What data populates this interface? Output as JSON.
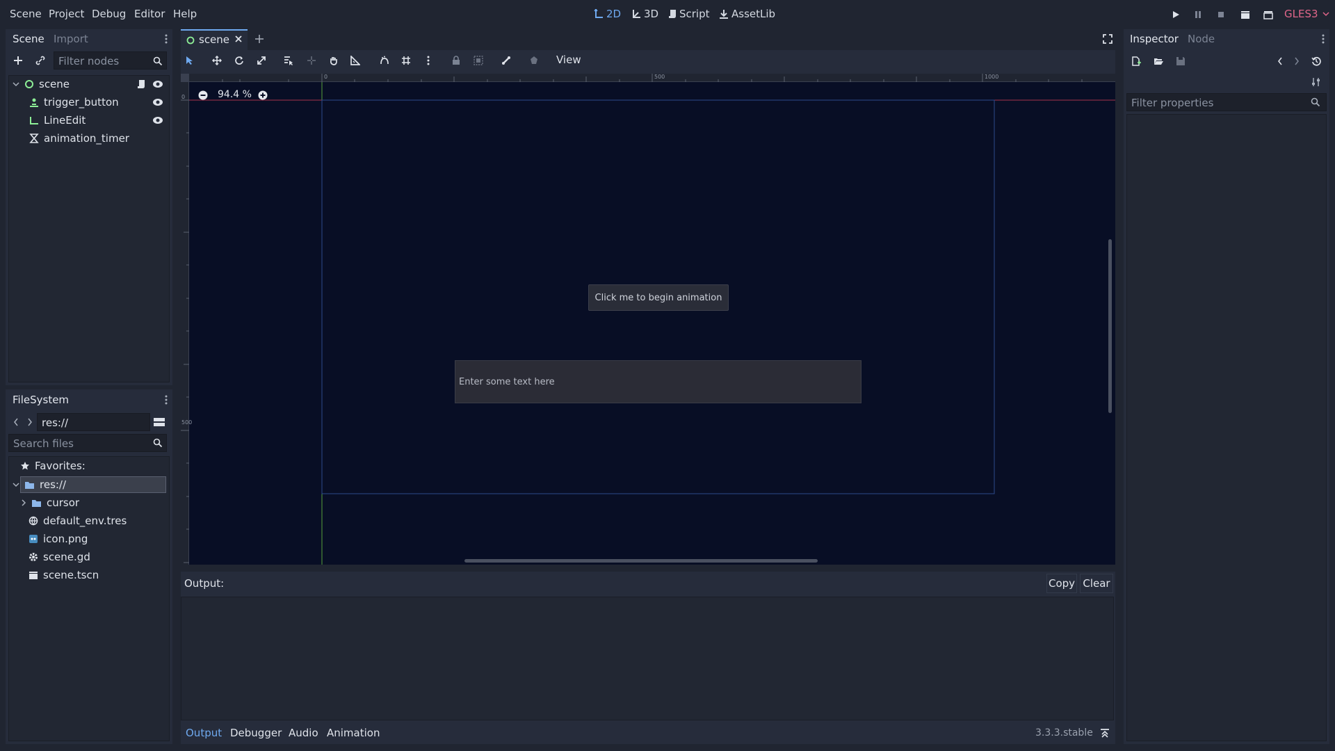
{
  "menu": [
    "Scene",
    "Project",
    "Debug",
    "Editor",
    "Help"
  ],
  "workspaces": {
    "d2": "2D",
    "d3": "3D",
    "script": "Script",
    "assetlib": "AssetLib"
  },
  "renderer": "GLES3",
  "scene_dock": {
    "tabs": {
      "scene": "Scene",
      "import": "Import"
    },
    "filter_placeholder": "Filter nodes",
    "nodes": {
      "root": "scene",
      "n1": "trigger_button",
      "n2": "LineEdit",
      "n3": "animation_timer"
    }
  },
  "filesystem_dock": {
    "title": "FileSystem",
    "path": "res://",
    "search_placeholder": "Search files",
    "favorites": "Favorites:",
    "root": "res://",
    "items": {
      "cursor": "cursor",
      "env": "default_env.tres",
      "icon": "icon.png",
      "gd": "scene.gd",
      "tscn": "scene.tscn"
    }
  },
  "editor_tab": {
    "label": "scene"
  },
  "toolbar": {
    "view": "View"
  },
  "viewport": {
    "zoom": "94.4 %",
    "ruler_top": {
      "t0": "0",
      "t500": "500",
      "t1000": "1000"
    },
    "ruler_left": {
      "t0": "0",
      "t500": "500"
    },
    "button_text": "Click me to begin animation",
    "lineedit_placeholder": "Enter some text here"
  },
  "output": {
    "label": "Output:",
    "copy": "Copy",
    "clear": "Clear"
  },
  "bottom_tabs": {
    "output": "Output",
    "debugger": "Debugger",
    "audio": "Audio",
    "animation": "Animation"
  },
  "version": "3.3.3.stable",
  "inspector": {
    "tabs": {
      "inspector": "Inspector",
      "node": "Node"
    },
    "filter_placeholder": "Filter properties"
  },
  "colors": {
    "accent": "#6fa9ef",
    "renderer": "#e0668a",
    "viewport_bg": "#080e25",
    "panel": "#262c3b"
  }
}
